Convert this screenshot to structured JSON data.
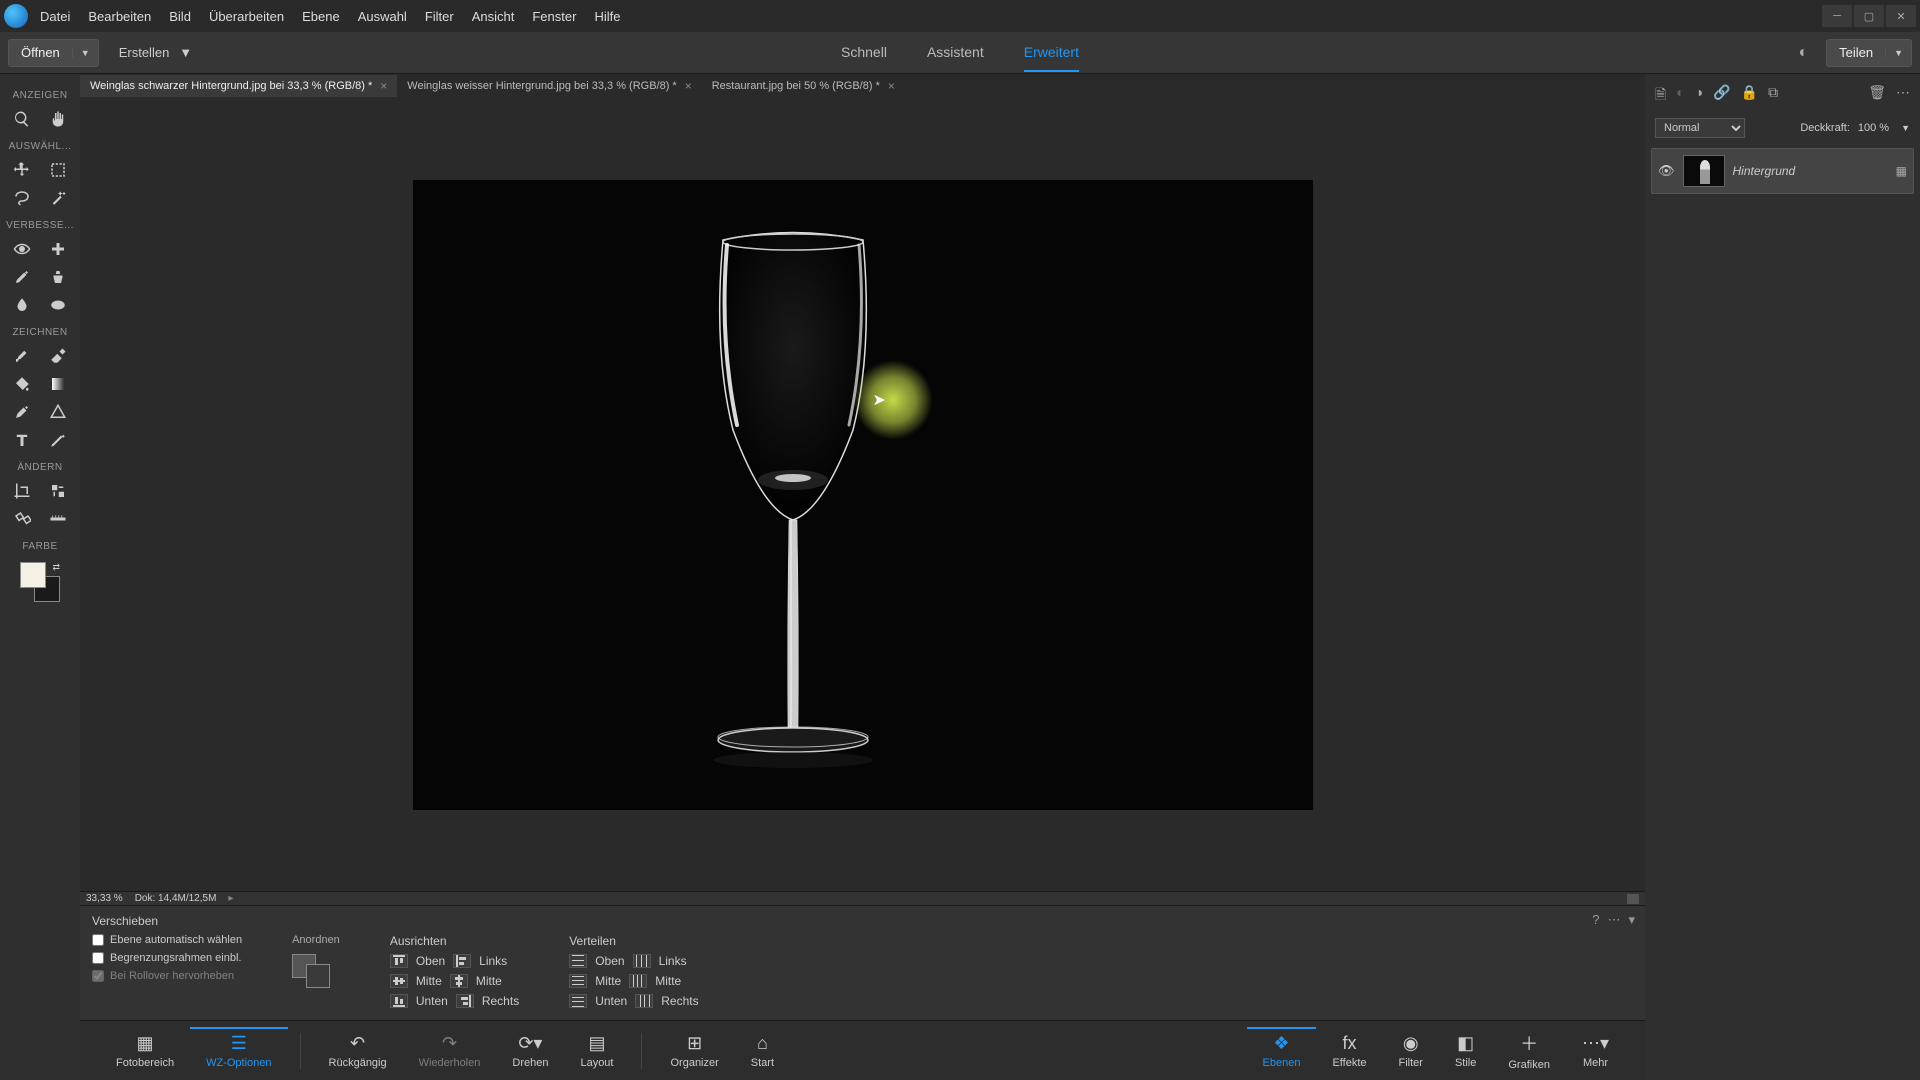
{
  "menu": {
    "items": [
      "Datei",
      "Bearbeiten",
      "Bild",
      "Überarbeiten",
      "Ebene",
      "Auswahl",
      "Filter",
      "Ansicht",
      "Fenster",
      "Hilfe"
    ]
  },
  "toolbar": {
    "open": "Öffnen",
    "create": "Erstellen",
    "share": "Teilen"
  },
  "modes": {
    "quick": "Schnell",
    "guided": "Assistent",
    "expert": "Erweitert"
  },
  "docTabs": [
    {
      "label": "Weinglas schwarzer Hintergrund.jpg bei 33,3 % (RGB/8) *",
      "active": true
    },
    {
      "label": "Weinglas weisser Hintergrund.jpg bei 33,3 % (RGB/8) *",
      "active": false
    },
    {
      "label": "Restaurant.jpg bei 50 % (RGB/8) *",
      "active": false
    }
  ],
  "leftSections": {
    "view": "ANZEIGEN",
    "select": "AUSWÄHL...",
    "enhance": "VERBESSE...",
    "draw": "ZEICHNEN",
    "modify": "ÄNDERN",
    "color": "FARBE"
  },
  "status": {
    "zoom": "33,33 %",
    "doc": "Dok: 14,4M/12,5M"
  },
  "optionsPanel": {
    "title": "Verschieben",
    "auto": "Ebene automatisch wählen",
    "bounds": "Begrenzungsrahmen einbl.",
    "rollover": "Bei Rollover hervorheben",
    "arrange": "Anordnen",
    "align": "Ausrichten",
    "distribute": "Verteilen",
    "top": "Oben",
    "middle": "Mitte",
    "bottom": "Unten",
    "left": "Links",
    "center": "Mitte",
    "right": "Rechts"
  },
  "bottomBar": {
    "photoBin": "Fotobereich",
    "toolOptions": "WZ-Optionen",
    "undo": "Rückgängig",
    "redo": "Wiederholen",
    "rotate": "Drehen",
    "layout": "Layout",
    "organizer": "Organizer",
    "home": "Start",
    "layers": "Ebenen",
    "effects": "Effekte",
    "filters": "Filter",
    "styles": "Stile",
    "graphics": "Grafiken",
    "more": "Mehr"
  },
  "layersPanel": {
    "blend": "Normal",
    "opacityLabel": "Deckkraft:",
    "opacity": "100 %",
    "layerName": "Hintergrund"
  }
}
